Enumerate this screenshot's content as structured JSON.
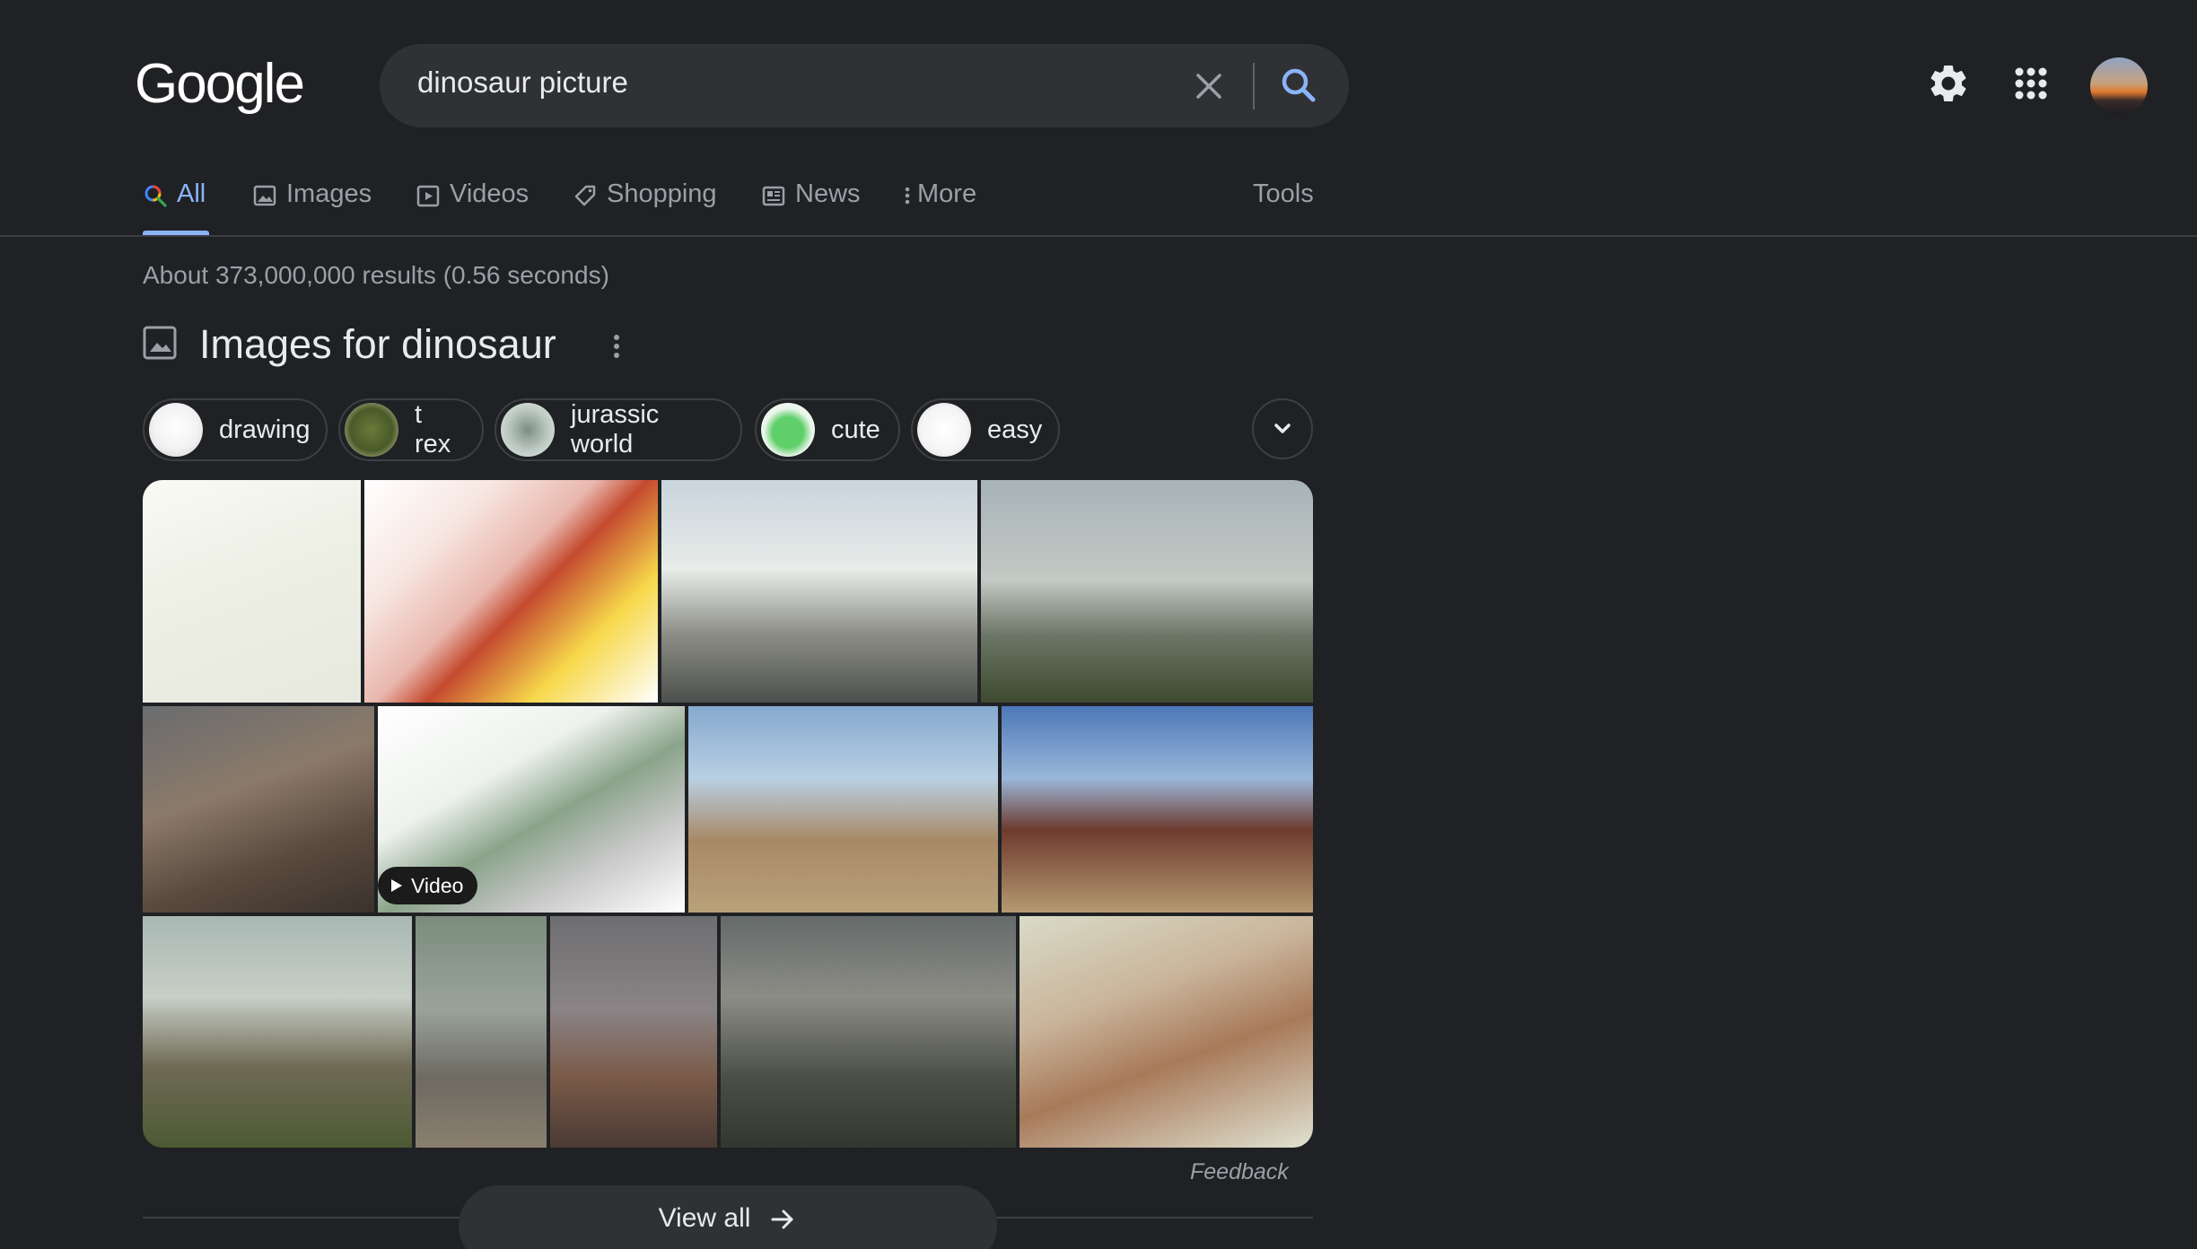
{
  "header": {
    "logo": "Google",
    "search": {
      "query": "dinosaur picture"
    }
  },
  "tabs": [
    {
      "label": "All",
      "icon": "search-icon",
      "active": true
    },
    {
      "label": "Images",
      "icon": "image-icon"
    },
    {
      "label": "Videos",
      "icon": "play-icon"
    },
    {
      "label": "Shopping",
      "icon": "tag-icon"
    },
    {
      "label": "News",
      "icon": "newspaper-icon"
    },
    {
      "label": "More",
      "icon": "more-vertical-icon"
    }
  ],
  "tools_label": "Tools",
  "result_stats": "About 373,000,000 results (0.56 seconds)",
  "images_section": {
    "title": "Images for dinosaur",
    "chips": [
      {
        "label": "drawing"
      },
      {
        "label": "t rex"
      },
      {
        "label": "jurassic world"
      },
      {
        "label": "cute"
      },
      {
        "label": "easy"
      }
    ],
    "video_badge": "Video",
    "feedback": "Feedback",
    "view_all": "View all"
  },
  "colors": {
    "background": "#202124",
    "surface": "#303134",
    "accent": "#8ab4f8",
    "text": "#e8eaed",
    "muted": "#9aa0a6",
    "border": "#3c4043"
  }
}
